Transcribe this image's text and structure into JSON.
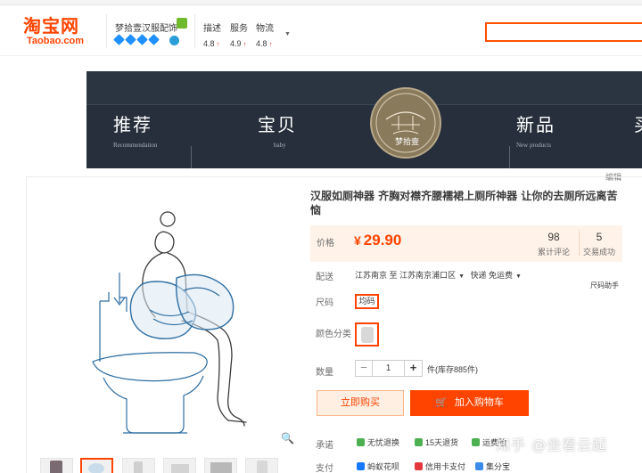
{
  "header": {
    "logo_cn": "淘宝网",
    "logo_en": "Taobao.com",
    "shop_name": "梦拾壹汉服配饰",
    "scores": [
      {
        "label": "描述",
        "value": "4.8"
      },
      {
        "label": "服务",
        "value": "4.9"
      },
      {
        "label": "物流",
        "value": "4.8"
      }
    ],
    "score_up_glyph": "↑",
    "more_glyph": "▼",
    "icons": [
      "shop-badge-icon",
      "diamond-icon",
      "vip-icon",
      "search-box"
    ]
  },
  "banner": {
    "nav": [
      {
        "cn": "推荐",
        "en": "Recommendation"
      },
      {
        "cn": "宝贝",
        "en": "baby"
      },
      {
        "cn": "新品",
        "en": "New products"
      },
      {
        "cn": "买",
        "en": ""
      }
    ],
    "logo_text": "梦拾壹"
  },
  "edit_link": "编辑",
  "product": {
    "title": "汉服如厕神器 齐胸对襟齐腰襦裙上厕所神器 让你的去厕所远离苦恼",
    "price_label": "价格",
    "currency": "¥",
    "price": "29.90",
    "stats": [
      {
        "value": "98",
        "label": "累计评论"
      },
      {
        "value": "5",
        "label": "交易成功"
      }
    ],
    "shipping_label": "配送",
    "ship_from": "江苏南京",
    "ship_to_word": "至",
    "ship_to": "江苏南京浦口区",
    "ship_option": "快递 免运费",
    "size_chart_link": "尺码助手",
    "size_label": "尺码",
    "size_option": "均码",
    "color_label": "颜色分类",
    "qty_label": "数量",
    "qty_minus": "−",
    "qty_value": "1",
    "qty_plus": "+",
    "qty_unit": "件(库存885件)",
    "buy_now": "立即购买",
    "add_cart": "加入购物车",
    "cart_icon_glyph": "🛒",
    "promise_label": "承诺",
    "promises": [
      {
        "text": "无忧退换",
        "color": "#4caf50"
      },
      {
        "text": "15天退货",
        "color": "#4caf50"
      },
      {
        "text": "运费险",
        "color": "#4caf50"
      }
    ],
    "pay_label": "支付",
    "payments": [
      {
        "text": "蚂蚁花呗",
        "color": "#1677ff"
      },
      {
        "text": "信用卡支付",
        "color": "#e4393c"
      },
      {
        "text": "集分宝",
        "color": "#3b8beb"
      }
    ],
    "zoom_glyph": "🔍",
    "thumb_count": 6
  },
  "watermark": "知乎 @坐看云起",
  "colors": {
    "brand": "#ff4400",
    "banner_bg": "#262f3b",
    "price_bg": "#fff2e8"
  }
}
